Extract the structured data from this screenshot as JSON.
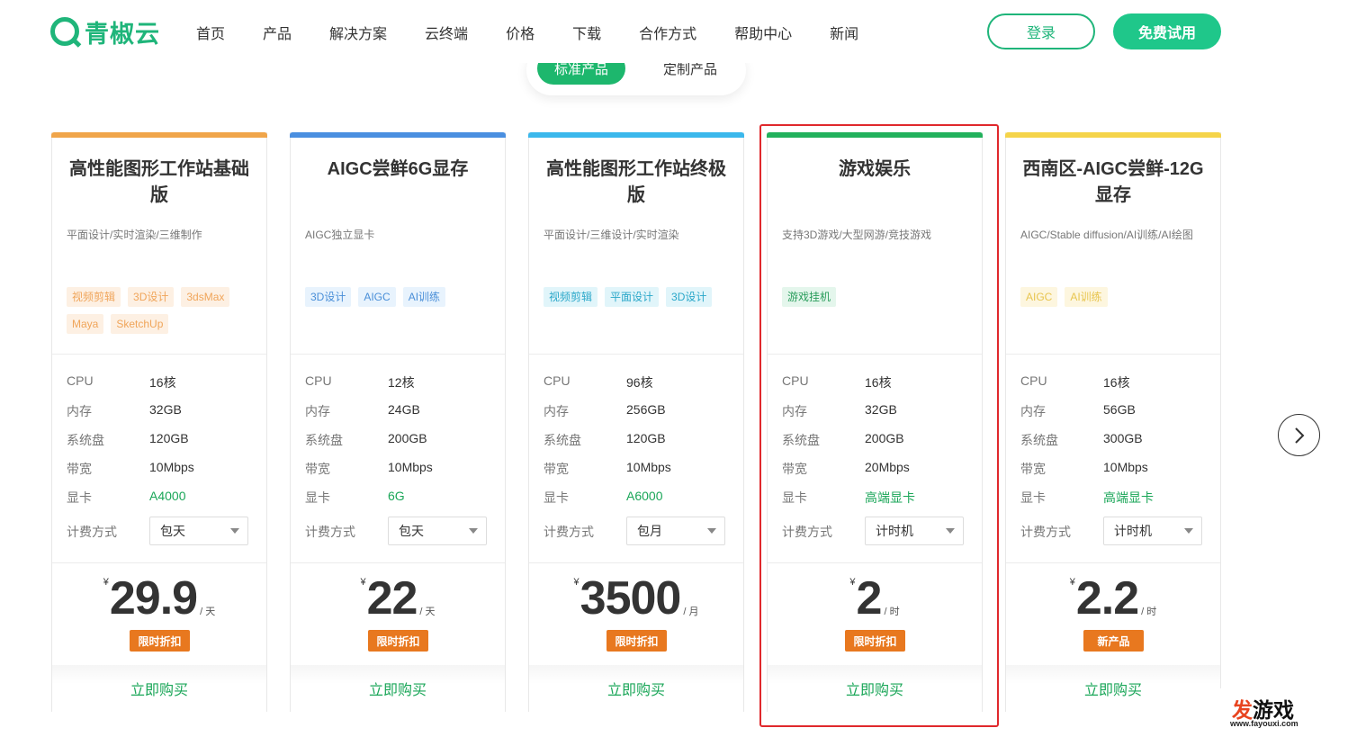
{
  "header": {
    "logo_text": "青椒云",
    "nav": [
      "首页",
      "产品",
      "解决方案",
      "云终端",
      "价格",
      "下载",
      "合作方式",
      "帮助中心",
      "新闻"
    ],
    "login_label": "登录",
    "trial_label": "免费试用"
  },
  "segment": {
    "active_label": "标准产品",
    "other_label": "定制产品"
  },
  "spec_labels": {
    "cpu": "CPU",
    "mem": "内存",
    "disk": "系统盘",
    "bw": "带宽",
    "gpu": "显卡",
    "billing": "计费方式"
  },
  "buy_label": "立即购买",
  "currency": "¥",
  "colors": {
    "brand": "#1fb57a",
    "highlight": "#e0282c",
    "badge": "#e8781f"
  },
  "cards": [
    {
      "title": "高性能图形工作站基础版",
      "desc": "平面设计/实时渲染/三维制作",
      "bar_color": "#f0a54a",
      "tags": [
        {
          "text": "视频剪辑",
          "style": "orange"
        },
        {
          "text": "3D设计",
          "style": "orange"
        },
        {
          "text": "3dsMax",
          "style": "orange"
        },
        {
          "text": "Maya",
          "style": "orange"
        },
        {
          "text": "SketchUp",
          "style": "orange"
        }
      ],
      "cpu": "16核",
      "mem": "32GB",
      "disk": "120GB",
      "bw": "10Mbps",
      "gpu": "A4000",
      "billing": "包天",
      "price": "29.9",
      "unit": "/ 天",
      "badge": "限时折扣"
    },
    {
      "title": "AIGC尝鲜6G显存",
      "desc": "AIGC独立显卡",
      "bar_color": "#4a8fe0",
      "tags": [
        {
          "text": "3D设计",
          "style": "blue"
        },
        {
          "text": "AIGC",
          "style": "blue"
        },
        {
          "text": "AI训练",
          "style": "blue"
        }
      ],
      "cpu": "12核",
      "mem": "24GB",
      "disk": "200GB",
      "bw": "10Mbps",
      "gpu": "6G",
      "billing": "包天",
      "price": "22",
      "unit": "/ 天",
      "badge": "限时折扣"
    },
    {
      "title": "高性能图形工作站终极版",
      "desc": "平面设计/三维设计/实时渲染",
      "bar_color": "#3bb8ec",
      "tags": [
        {
          "text": "视频剪辑",
          "style": "cyan"
        },
        {
          "text": "平面设计",
          "style": "cyan"
        },
        {
          "text": "3D设计",
          "style": "cyan"
        }
      ],
      "cpu": "96核",
      "mem": "256GB",
      "disk": "120GB",
      "bw": "10Mbps",
      "gpu": "A6000",
      "billing": "包月",
      "price": "3500",
      "unit": "/ 月",
      "badge": "限时折扣"
    },
    {
      "title": "游戏娱乐",
      "desc": "支持3D游戏/大型网游/竞技游戏",
      "bar_color": "#22b15c",
      "tags": [
        {
          "text": "游戏挂机",
          "style": "green"
        }
      ],
      "cpu": "16核",
      "mem": "32GB",
      "disk": "200GB",
      "bw": "20Mbps",
      "gpu": "高端显卡",
      "billing": "计时机",
      "price": "2",
      "unit": "/ 时",
      "badge": "限时折扣"
    },
    {
      "title": "西南区-AIGC尝鲜-12G显存",
      "desc": "AIGC/Stable diffusion/AI训练/AI绘图",
      "bar_color": "#f5d44a",
      "tags": [
        {
          "text": "AIGC",
          "style": "yellow"
        },
        {
          "text": "AI训练",
          "style": "yellow"
        }
      ],
      "cpu": "16核",
      "mem": "56GB",
      "disk": "300GB",
      "bw": "10Mbps",
      "gpu": "高端显卡",
      "billing": "计时机",
      "price": "2.2",
      "unit": "/ 时",
      "badge": "新产品"
    }
  ],
  "watermark": {
    "logo_a": "发",
    "logo_b": "游戏",
    "url": "www.fayouxi.com"
  }
}
